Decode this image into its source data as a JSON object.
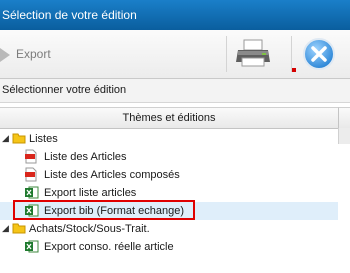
{
  "window": {
    "title": "Sélection de votre édition"
  },
  "toolbar": {
    "export_label": "Export"
  },
  "selector": {
    "label": "Sélectionner votre édition"
  },
  "tree": {
    "column_header": "Thèmes et éditions",
    "nodes": [
      {
        "label": "Listes",
        "icon": "folder-icon"
      },
      {
        "label": "Liste des Articles",
        "icon": "pdf-icon"
      },
      {
        "label": "Liste des Articles composés",
        "icon": "pdf-icon"
      },
      {
        "label": "Export liste articles",
        "icon": "excel-icon"
      },
      {
        "label": "Export bib (Format echange)",
        "icon": "excel-icon",
        "selected": true
      },
      {
        "label": "Achats/Stock/Sous-Trait.",
        "icon": "folder-icon"
      },
      {
        "label": "Export conso. réelle article",
        "icon": "excel-icon"
      }
    ]
  },
  "colors": {
    "titlebar": "#0f6fb8",
    "highlight": "#e00000",
    "selection": "#dfeefa"
  }
}
